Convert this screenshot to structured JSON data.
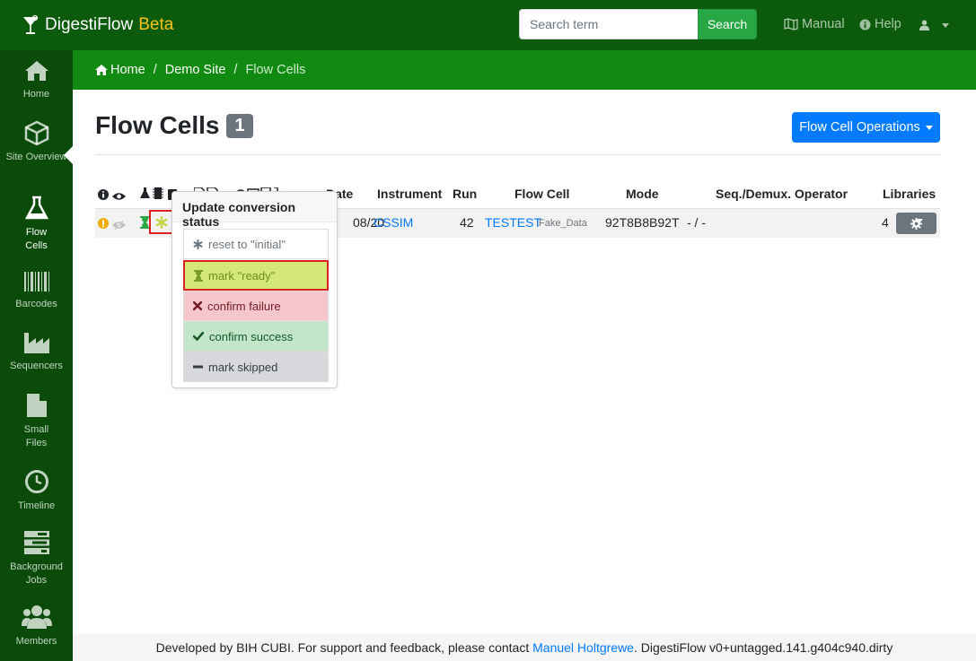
{
  "app": {
    "name": "DigestiFlow",
    "badge": "Beta"
  },
  "search": {
    "placeholder": "Search term",
    "button_label": "Search"
  },
  "nav": {
    "manual_label": "Manual",
    "help_label": "Help"
  },
  "sidebar": {
    "items": [
      {
        "label": "Home",
        "icon": "home-icon"
      },
      {
        "label": "Site Overview",
        "icon": "cube-icon"
      },
      {
        "label": "Flow Cells",
        "icon": "flask-icon",
        "active": true
      },
      {
        "label": "Barcodes",
        "icon": "barcode-icon"
      },
      {
        "label": "Sequencers",
        "icon": "industry-icon"
      },
      {
        "label": "Small Files",
        "icon": "file-icon"
      },
      {
        "label": "Timeline",
        "icon": "clock-icon"
      },
      {
        "label": "Background Jobs",
        "icon": "tasks-icon"
      },
      {
        "label": "Members",
        "icon": "users-icon"
      }
    ]
  },
  "breadcrumb": {
    "home": "Home",
    "site": "Demo Site",
    "current": "Flow Cells"
  },
  "page": {
    "title": "Flow Cells",
    "count": "1",
    "operations_label": "Flow Cell Operations"
  },
  "table": {
    "headers": {
      "date": "Date",
      "instrument": "Instrument",
      "run": "Run",
      "flowcell": "Flow Cell",
      "mode": "Mode",
      "operator": "Seq./Demux. Operator",
      "libraries": "Libraries"
    },
    "row": {
      "date": "08/20",
      "instrument": "CSSIM",
      "run": "42",
      "flowcell": "TESTEST",
      "flowcell_label": "Fake_Data",
      "mode": "92T8B8B92T",
      "operator": "- / -",
      "libraries": "4"
    }
  },
  "popover": {
    "title": "Update conversion status",
    "items": {
      "initial": "reset to \"initial\"",
      "ready": "mark \"ready\"",
      "failure": "confirm failure",
      "success": "confirm success",
      "skipped": "mark skipped"
    }
  },
  "footer": {
    "prefix": "Developed by BIH CUBI. For support and feedback, please contact",
    "contact": "Manuel Holtgrewe",
    "suffix": ". DigestiFlow v0+untagged.141.g404c940.dirty"
  },
  "colors": {
    "navbar": "#0c5a0c",
    "sidebar": "#0a4b0a",
    "breadcrumb_bar": "#118a11",
    "primary": "#007bff",
    "success": "#28a745",
    "highlight": "#e02020"
  }
}
